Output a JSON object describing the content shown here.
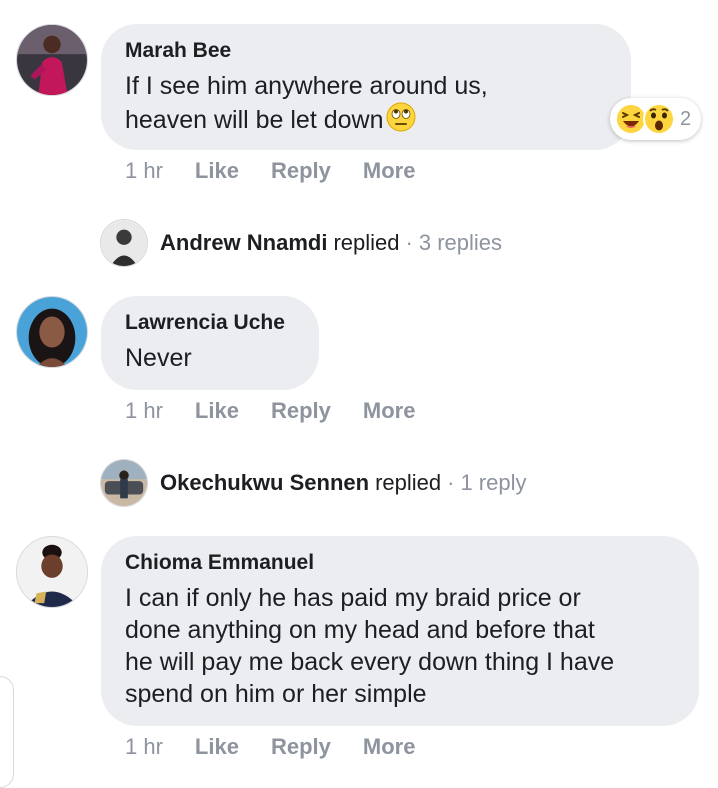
{
  "comments": [
    {
      "author": "Marah Bee",
      "line1": "If I see him anywhere around us,",
      "line2": "heaven will be let down",
      "time": "1 hr",
      "like": "Like",
      "reply": "Reply",
      "more": "More",
      "reactions": {
        "icons": [
          "laughing-face",
          "surprised-face"
        ],
        "count": "2"
      },
      "inline_emoji": "face-with-rolling-eyes"
    },
    {
      "author": "Lawrencia Uche",
      "text": "Never",
      "time": "1 hr",
      "like": "Like",
      "reply": "Reply",
      "more": "More"
    },
    {
      "author": "Chioma Emmanuel",
      "lines": [
        "I can if only he has paid my braid price or",
        "done anything on my head and before that",
        "he will pay me back every down thing I have",
        "spend on him or her simple"
      ],
      "time": "1 hr",
      "like": "Like",
      "reply": "Reply",
      "more": "More"
    }
  ],
  "replies": [
    {
      "name": "Andrew Nnamdi",
      "verb": "replied",
      "dot": "·",
      "count": "3 replies"
    },
    {
      "name": "Okechukwu Sennen",
      "verb": "replied",
      "dot": "·",
      "count": "1 reply"
    }
  ],
  "colors": {
    "bubble": "#ebedf0",
    "text": "#1c1e21",
    "meta": "#8d949e"
  }
}
